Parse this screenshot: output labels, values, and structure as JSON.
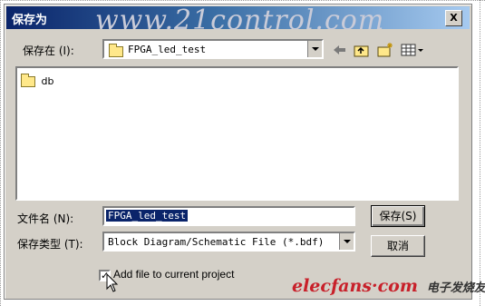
{
  "window": {
    "title": "保存为",
    "watermark": "www.21control.com",
    "close_label": "X"
  },
  "save_in": {
    "label": "保存在 (I):",
    "value": "FPGA_led_test"
  },
  "toolbar": {
    "icons": [
      "back-arrow-icon",
      "up-one-level-icon",
      "new-folder-icon",
      "view-menu-icon"
    ]
  },
  "file_list": {
    "items": [
      {
        "name": "db",
        "icon": "folder-icon"
      }
    ]
  },
  "file_name": {
    "label": "文件名 (N):",
    "value": "FPGA_led_test"
  },
  "save_type": {
    "label": "保存类型 (T):",
    "value": "Block Diagram/Schematic File (*.bdf)"
  },
  "buttons": {
    "save": "保存(S)",
    "cancel": "取消"
  },
  "checkbox": {
    "label": "Add file to current project",
    "checked": true,
    "mark": "✓"
  },
  "branding": {
    "site": "elecfans·com",
    "tagline": "电子发烧友"
  },
  "colors": {
    "title_bar": "#0a246a",
    "dialog_bg": "#d4d0c8",
    "selection": "#0a246a",
    "brand_red": "#c8202a"
  }
}
